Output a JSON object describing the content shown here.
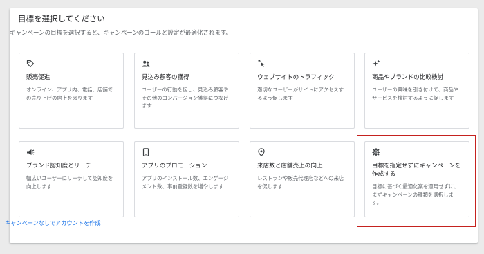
{
  "header": {
    "title": "目標を選択してください"
  },
  "subtitle": "キャンペーンの目標を選択すると、キャンペーンのゴールと設定が最適化されます。",
  "cards": [
    {
      "icon": "tag-icon",
      "title": "販売促進",
      "desc": "オンライン、アプリ内、電話、店舗での売り上げの向上を図ります"
    },
    {
      "icon": "people-icon",
      "title": "見込み顧客の獲得",
      "desc": "ユーザーの行動を促し、見込み顧客やその他のコンバージョン獲得につなげます"
    },
    {
      "icon": "click-icon",
      "title": "ウェブサイトのトラフィック",
      "desc": "適切なユーザーがサイトにアクセスするよう促します"
    },
    {
      "icon": "sparkle-icon",
      "title": "商品やブランドの比較検討",
      "desc": "ユーザーの興味を引き付けて、商品やサービスを検討するように促します"
    },
    {
      "icon": "megaphone-icon",
      "title": "ブランド認知度とリーチ",
      "desc": "幅広いユーザーにリーチして認知度を向上します"
    },
    {
      "icon": "phone-icon",
      "title": "アプリのプロモーション",
      "desc": "アプリのインストール数、エンゲージメント数、事前登録数を増やします"
    },
    {
      "icon": "location-pin-icon",
      "title": "来店数と店舗売上の向上",
      "desc": "レストランや販売代理店などへの来店を促します"
    },
    {
      "icon": "gear-icon",
      "title": "目標を指定せずにキャンペーンを作成する",
      "desc": "目標に基づく最適化案を適用せずに、まずキャンペーンの種類を選択します。"
    }
  ],
  "footer": {
    "link": "キャンペーンなしでアカウントを作成"
  },
  "colors": {
    "highlight": "#c5221f",
    "link": "#1a73e8"
  }
}
